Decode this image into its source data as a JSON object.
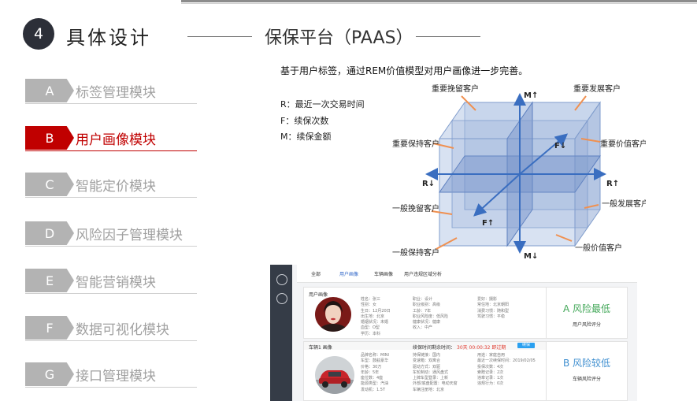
{
  "header": {
    "number": "4",
    "title": "具体设计",
    "section": "保保平台（PAAS）"
  },
  "nav": {
    "items": [
      {
        "letter": "A",
        "label": "标签管理模块"
      },
      {
        "letter": "B",
        "label": "用户画像模块"
      },
      {
        "letter": "C",
        "label": "智能定价模块"
      },
      {
        "letter": "D",
        "label": "风险因子管理模块"
      },
      {
        "letter": "E",
        "label": "智能营销模块"
      },
      {
        "letter": "F",
        "label": "数据可视化模块"
      },
      {
        "letter": "G",
        "label": "接口管理模块"
      }
    ],
    "active": 1
  },
  "content": {
    "intro": "基于用户标签，通过REM价值模型对用户画像进一步完善。",
    "legend": [
      "R：最近一次交易时间",
      "F：续保次数",
      "M：续保金额"
    ]
  },
  "diagram": {
    "axes": {
      "m_up": "M↑",
      "m_down": "M↓",
      "r_left": "R↓",
      "r_right": "R↑",
      "f_up": "F↓",
      "f_down": "F↑"
    },
    "segments": {
      "important_retain": "重要挽留客户",
      "important_develop": "重要发展客户",
      "important_keep": "重要保持客户",
      "important_value": "重要价值客户",
      "general_retain": "一般挽留客户",
      "general_develop": "一般发展客户",
      "general_keep": "一般保持客户",
      "general_value": "一般价值客户"
    }
  },
  "screenshot": {
    "tabs": [
      "全部",
      "用户画像",
      "车辆画像",
      "用户违规区域分析"
    ],
    "user_card": {
      "title": "用户画像",
      "col1": "姓名：张三\n性别：女\n生日：12月20日\n出生地：北京\n婚姻状况：未婚\n血型：O型\n学历：本科",
      "col2": "职业：设计\n职业级别：高级\n工龄：7年\n职业风险度：低风险\n健康状况：健康\n收入：中产",
      "col3": "爱好：摄影\n常住地：北京朝阳\n消费习惯：随和型\n驾驶习惯：平稳",
      "risk_level": "A 风险最低",
      "risk_label": "用户风险评分"
    },
    "vehicle_card": {
      "title": "车辆1 画像",
      "renew_label": "续保时间剩余时间：",
      "renew_time": "30天 00:00:32 即过期",
      "renew_button": "续保",
      "col1": "品牌名称：MINI\n车型：鼓舷豪华\n价格：30万\n年龄：5年\n座位数：4座\n能源类型：汽油\n发动机：1.5T",
      "col2": "持保链接：国内\n变速箱：双离合\n驱动方式：双驱\n车轮制动：通风盘式\n上牌车型登录：上新\n外部/底盘配置：电动天窗\n车辆注册地：北京",
      "col3": "用途：家庭自用\n最近一次续保时间：2019/02/05\n投保次数：4次\n索赔记录：2次\n违章记录：1次\n违规行为：0次",
      "risk_level": "B 风险较低",
      "risk_label": "车辆风险评分"
    }
  },
  "colors": {
    "accent": "#c00000",
    "inactive": "#b3b3b3",
    "risk_low": "#44a85a",
    "risk_mid": "#3f8fd0",
    "arrow": "#3a6ec0",
    "pointer": "#f09050",
    "renew": "#e03a2f"
  }
}
